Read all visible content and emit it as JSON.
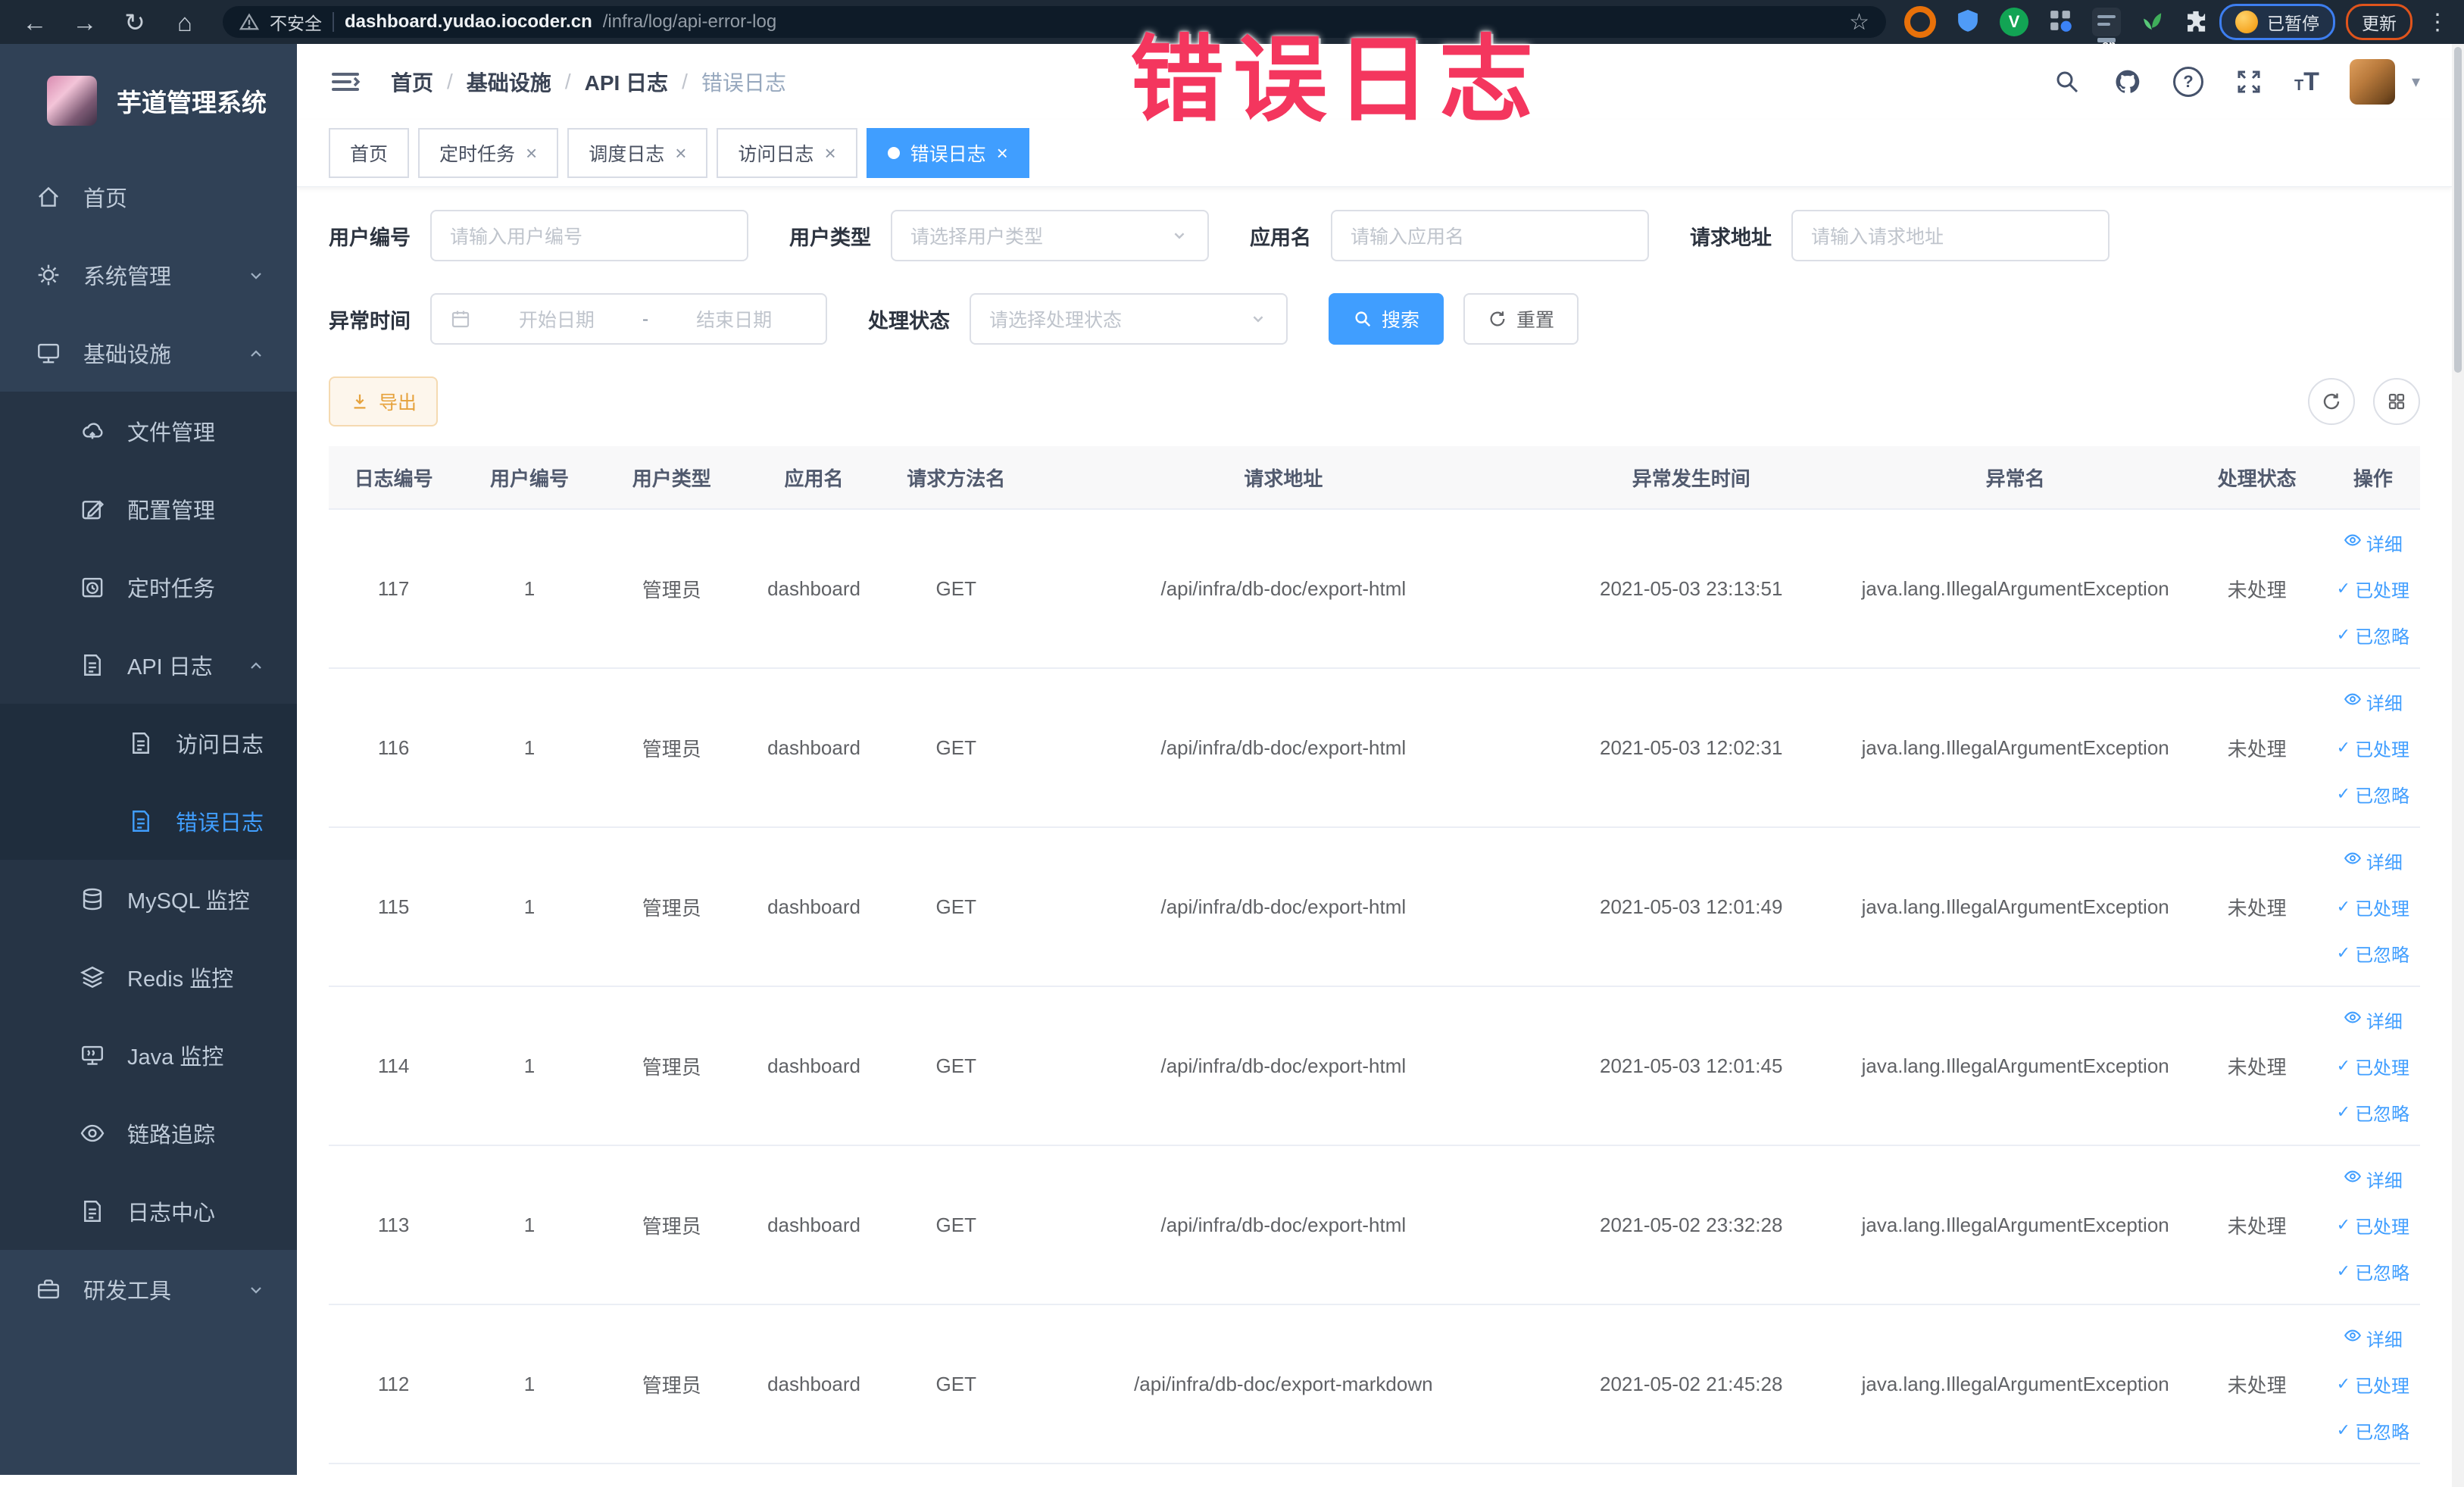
{
  "browser": {
    "security_label": "不安全",
    "url_host": "dashboard.yudao.iocoder.cn",
    "url_path": "/infra/log/api-error-log",
    "paused_label": "已暂停",
    "update_label": "更新",
    "nav_icons": [
      "back-icon",
      "forward-icon",
      "reload-icon",
      "home-icon"
    ],
    "extension_icons": [
      "bookmark-star-icon",
      "orange-donut-extension-icon",
      "blue-shield-extension-icon",
      "green-v-extension-icon",
      "grid-extension-icon",
      "on-badge-extension-icon",
      "leaf-extension-icon",
      "puzzle-extensions-icon"
    ]
  },
  "annotation": {
    "text": "错误日志",
    "color": "#f4365e"
  },
  "sidebar": {
    "logo_title": "芋道管理系统",
    "items": [
      {
        "key": "home",
        "label": "首页",
        "icon": "home-icon",
        "level": 1
      },
      {
        "key": "system-mgmt",
        "label": "系统管理",
        "icon": "gear-icon",
        "level": 1,
        "chevron": "down"
      },
      {
        "key": "infrastructure",
        "label": "基础设施",
        "icon": "monitor-icon",
        "level": 1,
        "chevron": "up"
      },
      {
        "key": "file-mgmt",
        "label": "文件管理",
        "icon": "cloud-icon",
        "level": 2
      },
      {
        "key": "config-mgmt",
        "label": "配置管理",
        "icon": "edit-icon",
        "level": 2
      },
      {
        "key": "scheduled-tasks",
        "label": "定时任务",
        "icon": "timer-icon",
        "level": 2
      },
      {
        "key": "api-log",
        "label": "API 日志",
        "icon": "log-icon",
        "level": 2,
        "chevron": "up"
      },
      {
        "key": "access-log",
        "label": "访问日志",
        "icon": "log-icon",
        "level": 3
      },
      {
        "key": "error-log",
        "label": "错误日志",
        "icon": "log-icon",
        "level": 3,
        "active": true
      },
      {
        "key": "mysql-monitor",
        "label": "MySQL 监控",
        "icon": "database-icon",
        "level": 2
      },
      {
        "key": "redis-monitor",
        "label": "Redis 监控",
        "icon": "layers-icon",
        "level": 2
      },
      {
        "key": "java-monitor",
        "label": "Java 监控",
        "icon": "java-icon",
        "level": 2
      },
      {
        "key": "trace",
        "label": "链路追踪",
        "icon": "eye-icon",
        "level": 2
      },
      {
        "key": "log-center",
        "label": "日志中心",
        "icon": "log-icon",
        "level": 2
      },
      {
        "key": "dev-tools",
        "label": "研发工具",
        "icon": "toolbox-icon",
        "level": 1,
        "chevron": "down"
      }
    ]
  },
  "header": {
    "breadcrumb": [
      "首页",
      "基础设施",
      "API 日志",
      "错误日志"
    ],
    "right_icons": [
      "search-icon",
      "github-icon",
      "help-icon",
      "fullscreen-icon",
      "font-size-icon",
      "avatar",
      "chevron-down-icon"
    ]
  },
  "tabs": [
    {
      "key": "home",
      "label": "首页"
    },
    {
      "key": "scheduled-tasks",
      "label": "定时任务",
      "closable": true
    },
    {
      "key": "schedule-log",
      "label": "调度日志",
      "closable": true
    },
    {
      "key": "access-log",
      "label": "访问日志",
      "closable": true
    },
    {
      "key": "error-log",
      "label": "错误日志",
      "closable": true,
      "active": true
    }
  ],
  "filters": {
    "user_id": {
      "label": "用户编号",
      "placeholder": "请输入用户编号"
    },
    "user_type": {
      "label": "用户类型",
      "placeholder": "请选择用户类型"
    },
    "app_name": {
      "label": "应用名",
      "placeholder": "请输入应用名"
    },
    "request_url": {
      "label": "请求地址",
      "placeholder": "请输入请求地址"
    },
    "exception_time": {
      "label": "异常时间",
      "start_placeholder": "开始日期",
      "separator": "-",
      "end_placeholder": "结束日期"
    },
    "process_status": {
      "label": "处理状态",
      "placeholder": "请选择处理状态"
    },
    "search_label": "搜索",
    "reset_label": "重置"
  },
  "toolbar": {
    "export_label": "导出",
    "right_icons": [
      "refresh-icon",
      "column-settings-icon"
    ]
  },
  "table": {
    "columns": [
      "日志编号",
      "用户编号",
      "用户类型",
      "应用名",
      "请求方法名",
      "请求地址",
      "异常发生时间",
      "异常名",
      "处理状态",
      "操作"
    ],
    "actions": {
      "detail": "详细",
      "processed": "已处理",
      "ignored": "已忽略"
    },
    "rows": [
      {
        "log_id": "117",
        "user_id": "1",
        "user_type": "管理员",
        "app_name": "dashboard",
        "method": "GET",
        "url": "/api/infra/db-doc/export-html",
        "time": "2021-05-03 23:13:51",
        "exception": "java.lang.IllegalArgumentException",
        "status": "未处理"
      },
      {
        "log_id": "116",
        "user_id": "1",
        "user_type": "管理员",
        "app_name": "dashboard",
        "method": "GET",
        "url": "/api/infra/db-doc/export-html",
        "time": "2021-05-03 12:02:31",
        "exception": "java.lang.IllegalArgumentException",
        "status": "未处理"
      },
      {
        "log_id": "115",
        "user_id": "1",
        "user_type": "管理员",
        "app_name": "dashboard",
        "method": "GET",
        "url": "/api/infra/db-doc/export-html",
        "time": "2021-05-03 12:01:49",
        "exception": "java.lang.IllegalArgumentException",
        "status": "未处理"
      },
      {
        "log_id": "114",
        "user_id": "1",
        "user_type": "管理员",
        "app_name": "dashboard",
        "method": "GET",
        "url": "/api/infra/db-doc/export-html",
        "time": "2021-05-03 12:01:45",
        "exception": "java.lang.IllegalArgumentException",
        "status": "未处理"
      },
      {
        "log_id": "113",
        "user_id": "1",
        "user_type": "管理员",
        "app_name": "dashboard",
        "method": "GET",
        "url": "/api/infra/db-doc/export-html",
        "time": "2021-05-02 23:32:28",
        "exception": "java.lang.IllegalArgumentException",
        "status": "未处理"
      },
      {
        "log_id": "112",
        "user_id": "1",
        "user_type": "管理员",
        "app_name": "dashboard",
        "method": "GET",
        "url": "/api/infra/db-doc/export-markdown",
        "time": "2021-05-02 21:45:28",
        "exception": "java.lang.IllegalArgumentException",
        "status": "未处理"
      }
    ]
  },
  "colors": {
    "accent": "#409eff",
    "warning": "#e6a23c",
    "annotation": "#f4365e",
    "sidebar_bg": "#304156",
    "submenu_bg": "#263445",
    "submenu_deep_bg": "#1f2d3d",
    "toolbar_bg": "#1d2936"
  }
}
